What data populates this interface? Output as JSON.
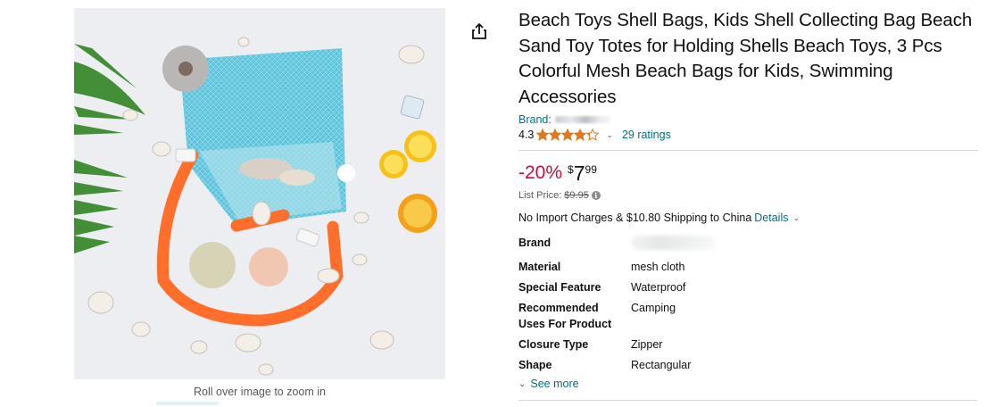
{
  "product": {
    "title": "Beach Toys Shell Bags, Kids Shell Collecting Bag Beach Sand Toy Totes for Holding Shells Beach Toys, 3 Pcs Colorful Mesh Beach Bags for Kids, Swimming Accessories",
    "brand_label": "Brand:",
    "rating_value": "4.3",
    "rating_fraction": 0.86,
    "ratings_count_label": "29 ratings"
  },
  "image": {
    "zoom_caption": "Roll over image to zoom in"
  },
  "price": {
    "discount": "-20%",
    "currency": "$",
    "whole": "7",
    "fraction": "99",
    "list_price_label": "List Price:",
    "list_price": "$9.95"
  },
  "shipping": {
    "text": "No Import Charges & $10.80 Shipping to China",
    "details_link": "Details"
  },
  "specs": [
    {
      "key": "Brand",
      "value": ""
    },
    {
      "key": "Material",
      "value": "mesh cloth"
    },
    {
      "key": "Special Feature",
      "value": "Waterproof"
    },
    {
      "key": "Recommended Uses For Product",
      "value": "Camping"
    },
    {
      "key": "Closure Type",
      "value": "Zipper"
    },
    {
      "key": "Shape",
      "value": "Rectangular"
    }
  ],
  "see_more_label": "See more",
  "icons": {
    "share": "share-icon",
    "star": "star-icon",
    "chevron": "chevron-down-icon",
    "info": "info-icon"
  },
  "colors": {
    "link": "#007185",
    "discount": "#cc0c39",
    "star": "#de7921",
    "text": "#0f1111"
  }
}
